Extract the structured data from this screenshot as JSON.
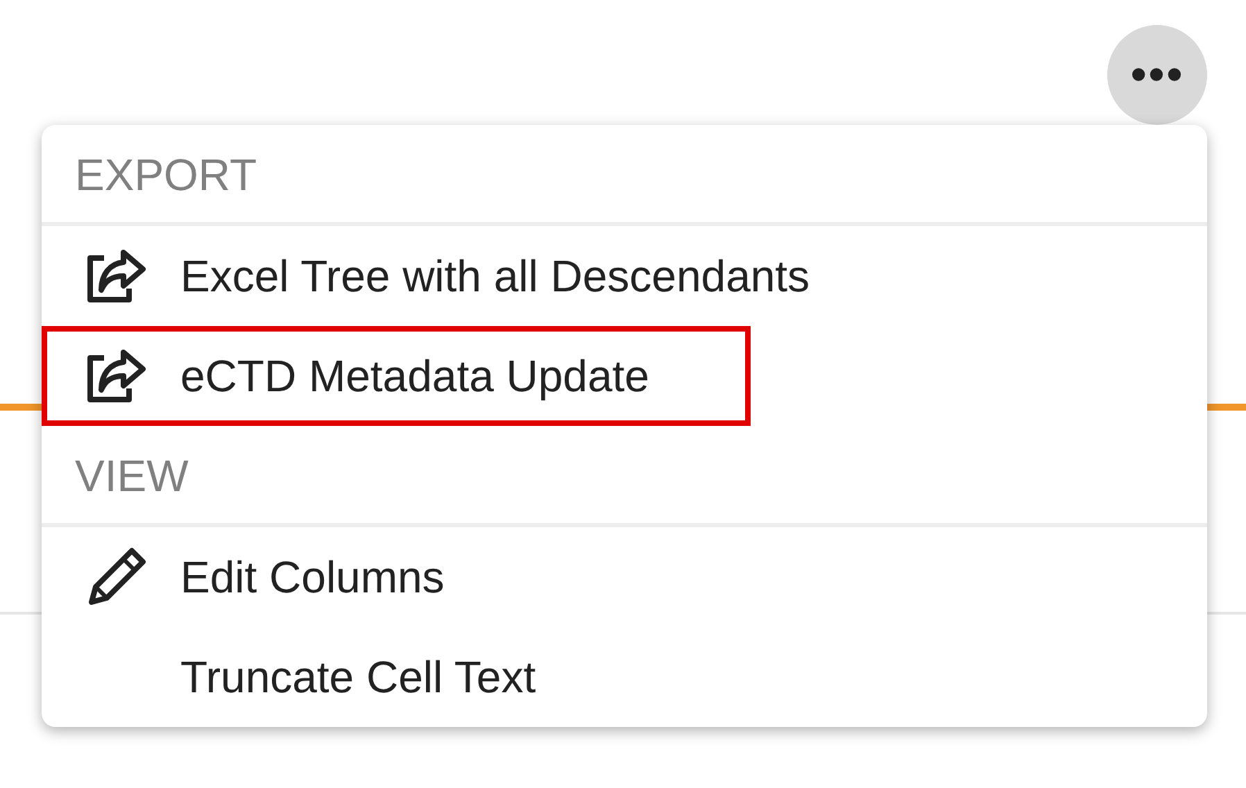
{
  "more_button": {
    "label": "•••"
  },
  "menu": {
    "sections": [
      {
        "title": "EXPORT",
        "items": [
          {
            "label": "Excel Tree with all Descendants",
            "kind": "export",
            "highlighted": false
          },
          {
            "label": "eCTD Metadata Update",
            "kind": "export",
            "highlighted": true
          }
        ]
      },
      {
        "title": "VIEW",
        "items": [
          {
            "label": "Edit Columns",
            "kind": "edit",
            "highlighted": false
          },
          {
            "label": "Truncate Cell Text",
            "kind": "toggle",
            "highlighted": false
          }
        ]
      }
    ]
  }
}
